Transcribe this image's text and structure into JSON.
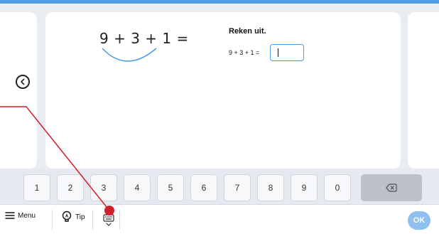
{
  "exercise": {
    "expression_big": "9 + 3 + 1 =",
    "instruction": "Reken uit.",
    "expression_small": "9 + 3 + 1 =",
    "answer_value": ""
  },
  "keypad": {
    "keys": [
      "1",
      "2",
      "3",
      "4",
      "5",
      "6",
      "7",
      "8",
      "9",
      "0"
    ],
    "backspace_icon": "backspace-icon"
  },
  "bottombar": {
    "menu_label": "Menu",
    "tip_label": "Tip",
    "ok_label": "OK",
    "keyboard_icon": "keyboard-icon"
  },
  "colors": {
    "accent": "#4f9be6",
    "ok_button": "#8fc0ee",
    "annotation": "#cc1f2b"
  }
}
